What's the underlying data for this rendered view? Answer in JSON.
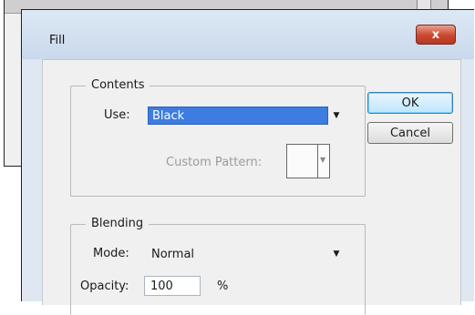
{
  "dialog": {
    "title": "Fill",
    "close_label": "x"
  },
  "contents": {
    "legend": "Contents",
    "use_label": "Use:",
    "use_value": "Black",
    "custom_pattern_label": "Custom Pattern:"
  },
  "blending": {
    "legend": "Blending",
    "mode_label": "Mode:",
    "mode_value": "Normal",
    "opacity_label": "Opacity:",
    "opacity_value": "100",
    "opacity_unit": "%"
  },
  "buttons": {
    "ok": "OK",
    "cancel": "Cancel"
  },
  "colors": {
    "selection": "#3d7ce0",
    "close_button": "#c9472f"
  }
}
